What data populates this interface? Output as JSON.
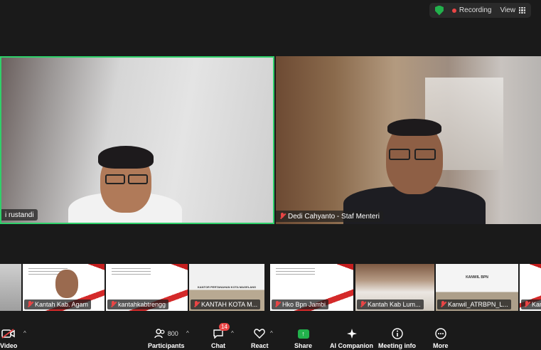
{
  "topbar": {
    "recording_label": "Recording",
    "view_label": "View",
    "colors": {
      "shield": "#22b14c",
      "record_dot": "#e94545"
    }
  },
  "video": {
    "speaker_left": {
      "name": "i rustandi",
      "active_border_color": "#2fd06a"
    },
    "speaker_right": {
      "name": "Dedi Cahyanto - Staf Menteri"
    }
  },
  "thumbnails": [
    {
      "label": ""
    },
    {
      "label": "Kantah Kab. Agam"
    },
    {
      "label": "kantahkabtrengg"
    },
    {
      "label": "KANTAH KOTA M..."
    },
    {
      "label": "Hko Bpn Jambi"
    },
    {
      "label": "Kantah Kab Lum..."
    },
    {
      "label": "Kanwil_ATRBPN_L..."
    },
    {
      "label": "Kan"
    }
  ],
  "thumbnail_text": {
    "office_sign": "KANTOR PERTANAHAN KOTA MAGELANG",
    "kanwil_sign": "KANWIL BPN"
  },
  "toolbar": {
    "video_label": "Video",
    "participants_label": "Participants",
    "participants_count": "800",
    "chat_label": "Chat",
    "chat_badge": "14",
    "react_label": "React",
    "share_label": "Share",
    "ai_label": "AI Companion",
    "info_label": "Meeting info",
    "more_label": "More"
  }
}
